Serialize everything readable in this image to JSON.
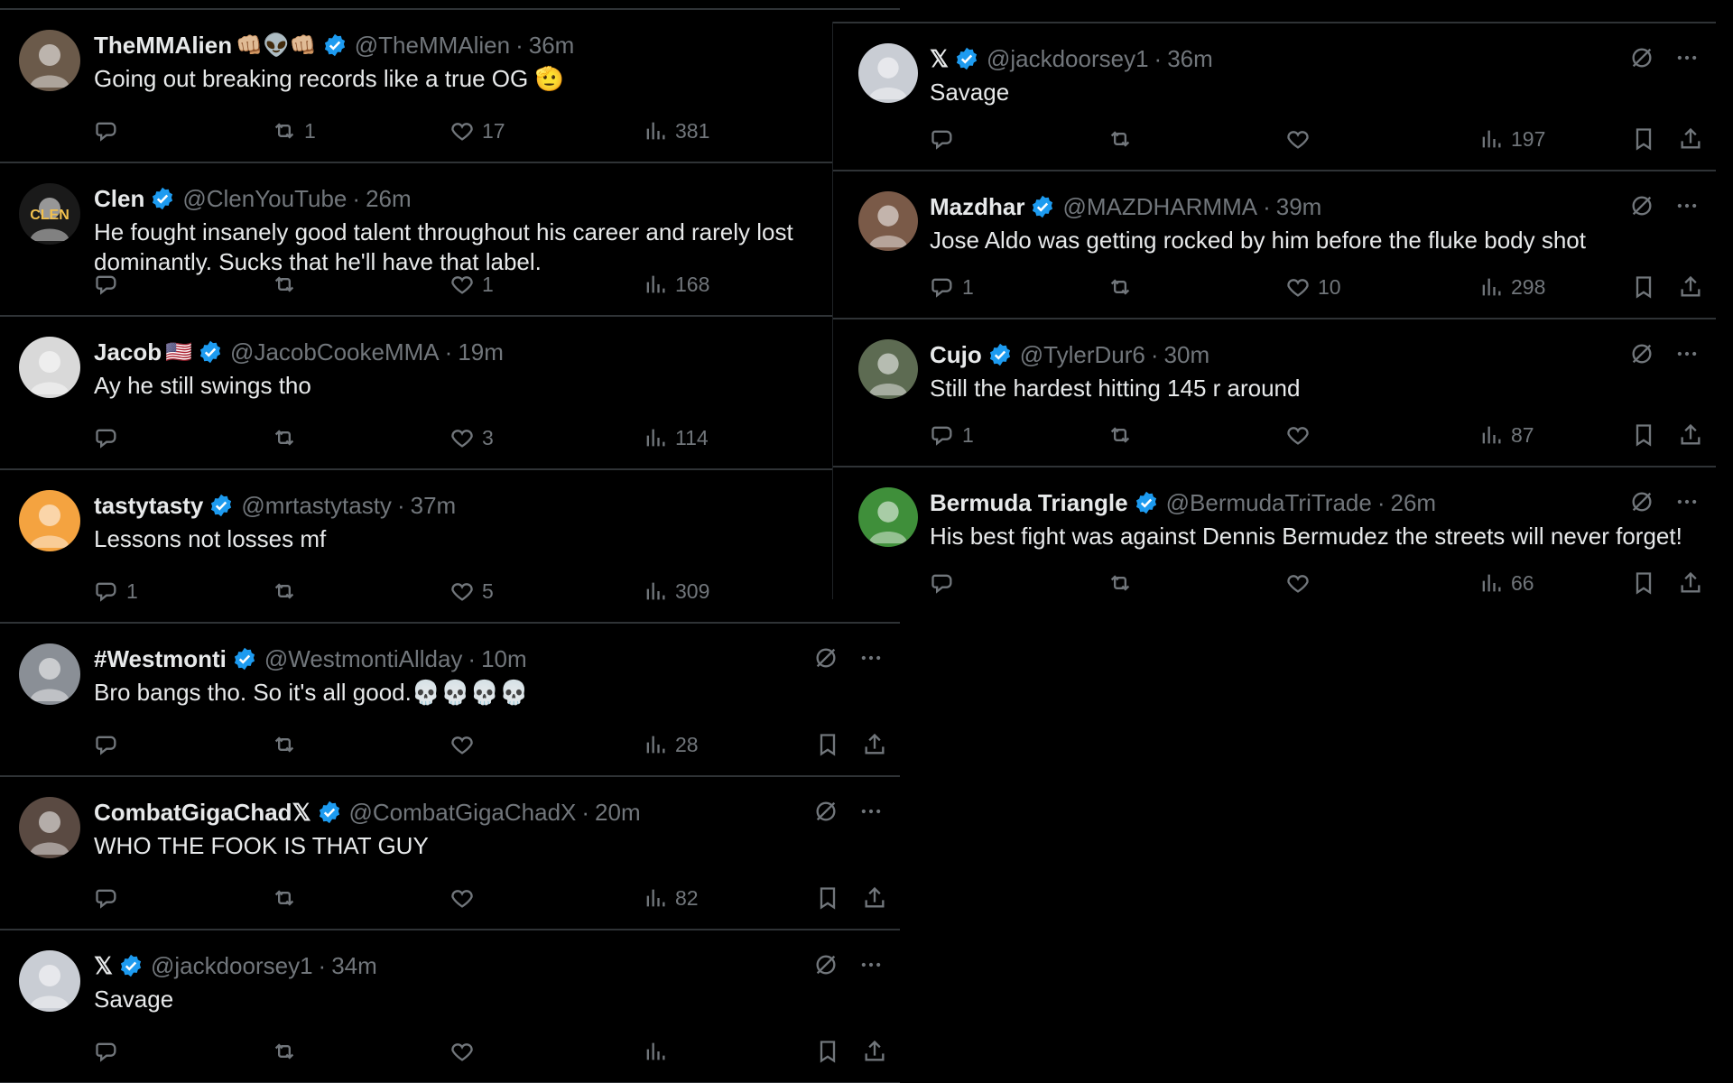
{
  "colors": {
    "background": "#000000",
    "text": "#e7e9ea",
    "muted": "#71767b",
    "verified": "#1d9bf0",
    "divider": "#2f3336"
  },
  "left_feed": [
    {
      "name": "TheMMAlien",
      "deco": "👊🏼👽👊🏼",
      "handle": "@TheMMAlien",
      "time": "36m",
      "text": "Going out breaking records like a true OG 🫡",
      "replies": "",
      "reposts": "1",
      "likes": "17",
      "views": "381",
      "avatar_icon": "alien-avatar",
      "avatar_color": "#6b5a4a",
      "show_tools": false
    },
    {
      "name": "Clen",
      "deco": "",
      "handle": "@ClenYouTube",
      "time": "26m",
      "text": "He fought insanely good talent throughout his career and rarely lost dominantly. Sucks that he'll have that label.",
      "replies": "",
      "reposts": "",
      "likes": "1",
      "views": "168",
      "avatar_icon": "clen-logo-avatar",
      "avatar_color": "#1a1a1a",
      "avatar_text": "CLEN",
      "show_tools": false
    },
    {
      "name": "Jacob",
      "deco": "🇺🇸",
      "handle": "@JacobCookeMMA",
      "time": "19m",
      "text": "Ay he still swings tho",
      "replies": "",
      "reposts": "",
      "likes": "3",
      "views": "114",
      "avatar_icon": "person-avatar",
      "avatar_color": "#d9d9d9",
      "show_tools": false
    },
    {
      "name": "tastytasty",
      "deco": "",
      "handle": "@mrtastytasty",
      "time": "37m",
      "text": "Lessons not losses mf",
      "replies": "1",
      "reposts": "",
      "likes": "5",
      "views": "309",
      "avatar_icon": "smiley-avatar",
      "avatar_color": "#f4a340",
      "show_tools": false
    },
    {
      "name": "#Westmonti",
      "deco": "",
      "handle": "@WestmontiAllday",
      "time": "10m",
      "text": "Bro bangs tho. So it's all good.💀💀💀💀",
      "replies": "",
      "reposts": "",
      "likes": "",
      "views": "28",
      "avatar_icon": "person-avatar",
      "avatar_color": "#8a8f96",
      "show_tools": true
    },
    {
      "name": "CombatGigaChad𝕏",
      "deco": "",
      "handle": "@CombatGigaChadX",
      "time": "20m",
      "text": "WHO THE FOOK IS THAT GUY",
      "replies": "",
      "reposts": "",
      "likes": "",
      "views": "82",
      "avatar_icon": "person-avatar",
      "avatar_color": "#5a4a42",
      "show_tools": true
    },
    {
      "name": "𝕏",
      "deco": "",
      "handle": "@jackdoorsey1",
      "time": "34m",
      "text": "Savage",
      "replies": "",
      "reposts": "",
      "likes": "",
      "views": "",
      "avatar_icon": "person-avatar",
      "avatar_color": "#c9cdd4",
      "show_tools": true
    }
  ],
  "right_feed": [
    {
      "name": "𝕏",
      "deco": "",
      "handle": "@jackdoorsey1",
      "time": "36m",
      "text": "Savage",
      "replies": "",
      "reposts": "",
      "likes": "",
      "views": "197",
      "avatar_icon": "person-avatar",
      "avatar_color": "#c9cdd4",
      "show_tools": true
    },
    {
      "name": "Mazdhar",
      "deco": "",
      "handle": "@MAZDHARMMA",
      "time": "39m",
      "text": "Jose Aldo was getting rocked by him before the fluke body shot",
      "replies": "1",
      "reposts": "",
      "likes": "10",
      "views": "298",
      "avatar_icon": "person-avatar",
      "avatar_color": "#7a5a48",
      "show_tools": true
    },
    {
      "name": "Cujo",
      "deco": "",
      "handle": "@TylerDur6",
      "time": "30m",
      "text": "Still the hardest hitting 145 r around",
      "replies": "1",
      "reposts": "",
      "likes": "",
      "views": "87",
      "avatar_icon": "group-avatar",
      "avatar_color": "#5d6b52",
      "show_tools": true
    },
    {
      "name": "Bermuda Triangle",
      "deco": "",
      "handle": "@BermudaTriTrade",
      "time": "26m",
      "text": "His best fight was against Dennis Bermudez the streets will never forget!",
      "replies": "",
      "reposts": "",
      "likes": "",
      "views": "66",
      "avatar_icon": "cartoon-avatar",
      "avatar_color": "#3f8f3a",
      "show_tools": true
    }
  ]
}
